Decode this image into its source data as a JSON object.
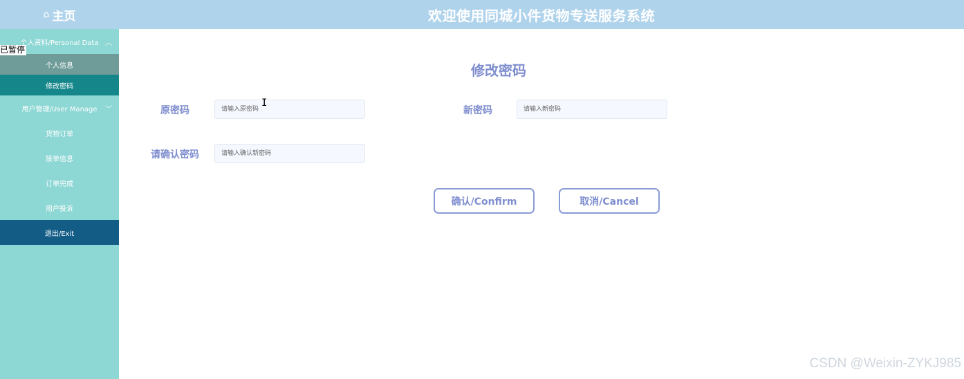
{
  "header": {
    "home_icon": "home-icon",
    "home_label": "主页",
    "title": "欢迎使用同城小件货物专送服务系统"
  },
  "sidebar": {
    "group1": {
      "label": "个人资料/Personal Data",
      "chevron": "^"
    },
    "sub_items": [
      {
        "label": "个人信息"
      },
      {
        "label": "修改密码",
        "active": true
      }
    ],
    "group2": {
      "label": "用户管理/User Manage",
      "chevron": "v"
    },
    "items": [
      {
        "label": "货物订单"
      },
      {
        "label": "接单信息"
      },
      {
        "label": "订单完成"
      },
      {
        "label": "用户投诉"
      }
    ],
    "exit_label": "退出/Exit"
  },
  "overlay": {
    "paused_text": "已暂停"
  },
  "form": {
    "title": "修改密码",
    "old_password": {
      "label": "原密码",
      "placeholder": "请输入原密码"
    },
    "new_password": {
      "label": "新密码",
      "placeholder": "请输入新密码"
    },
    "confirm_password": {
      "label": "请确认密码",
      "placeholder": "请输入确认新密码"
    },
    "confirm_button": "确认/Confirm",
    "cancel_button": "取消/Cancel"
  },
  "watermark": "CSDN @Weixin-ZYKJ985",
  "colors": {
    "topbar": "#b0d3ec",
    "sidebar": "#8dd7d4",
    "active_item": "#15868a",
    "exit_item": "#135c86",
    "accent_text": "#7f8ecf"
  }
}
